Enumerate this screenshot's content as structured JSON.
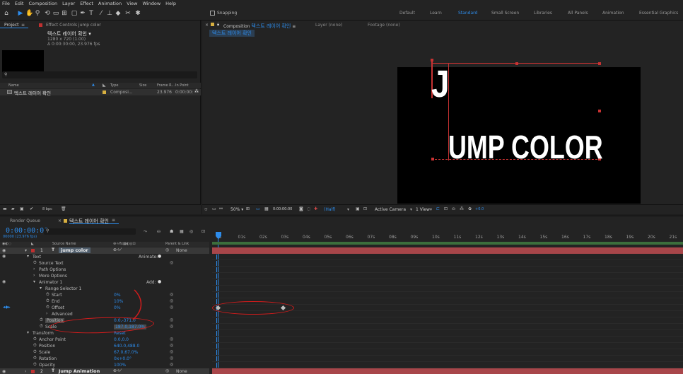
{
  "menu": [
    "File",
    "Edit",
    "Composition",
    "Layer",
    "Effect",
    "Animation",
    "View",
    "Window",
    "Help"
  ],
  "toolbar": {
    "snapping_label": "Snapping",
    "workspaces": [
      "Default",
      "Learn",
      "Standard",
      "Small Screen",
      "Libraries",
      "All Panels",
      "Animation",
      "Essential Graphics"
    ],
    "active_workspace": "Standard"
  },
  "project": {
    "tab_project": "Project",
    "tab_effect_controls": "Effect Controls jump color",
    "comp_name": "텍스트 레이어 확인",
    "comp_info_1": "1280 x 720 (1.00)",
    "comp_info_2": "Δ 0:00:30:00, 23.976 fps",
    "search_placeholder": "",
    "columns": [
      "Name",
      "Type",
      "Size",
      "Frame R...",
      "In Point"
    ],
    "items": [
      {
        "name": "텍스트 레이어 확인",
        "type": "Composi...",
        "size": "",
        "frame_rate": "23.976",
        "in_point": "0:00:00:"
      }
    ],
    "footer_bpc": "8 bpc"
  },
  "viewer": {
    "tab_composition": "Composition",
    "comp_tab_name": "텍스트 레이어 확인",
    "tab_layer": "Layer (none)",
    "tab_footage": "Footage (none)",
    "breadcrumb": "텍스트 레이어 확인",
    "canvas_text_top": "J",
    "canvas_text_main": "UMP COLOR",
    "footer": {
      "zoom": "50%",
      "timecode": "0:00:00:00",
      "resolution": "(Half)",
      "camera": "Active Camera",
      "views": "1 View",
      "exposure": "+0.0"
    }
  },
  "timeline": {
    "tab_render_queue": "Render Queue",
    "tab_comp": "텍스트 레이어 확인",
    "timecode": "0:00:00:00",
    "fps_note": "00000 (23.976 fps)",
    "search_placeholder": "",
    "columns": {
      "source_name": "Source Name",
      "parent_link": "Parent & Link"
    },
    "ruler": [
      "0s",
      "01s",
      "02s",
      "03s",
      "04s",
      "05s",
      "06s",
      "07s",
      "08s",
      "09s",
      "10s",
      "11s",
      "12s",
      "13s",
      "14s",
      "15s",
      "16s",
      "17s",
      "18s",
      "19s",
      "20s",
      "21s"
    ],
    "layers": [
      {
        "index": "1",
        "name": "jump color",
        "parent": "None"
      },
      {
        "index": "2",
        "name": "Jump Animation",
        "parent": "None"
      }
    ],
    "animate_label": "Animate:",
    "add_label": "Add:",
    "properties": [
      {
        "indent": 2,
        "label": "Text",
        "value": "",
        "twirl": "open"
      },
      {
        "indent": 3,
        "label": "Source Text",
        "value": "",
        "stopwatch": true
      },
      {
        "indent": 3,
        "label": "Path Options",
        "value": "",
        "twirl": "closed"
      },
      {
        "indent": 3,
        "label": "More Options",
        "value": "",
        "twirl": "closed"
      },
      {
        "indent": 3,
        "label": "Animator 1",
        "value": "",
        "twirl": "open"
      },
      {
        "indent": 4,
        "label": "Range Selector 1",
        "value": "",
        "twirl": "open"
      },
      {
        "indent": 5,
        "label": "Start",
        "value": "0%",
        "stopwatch": true
      },
      {
        "indent": 5,
        "label": "End",
        "value": "10%",
        "stopwatch": true
      },
      {
        "indent": 5,
        "label": "Offset",
        "value": "0%",
        "stopwatch": true
      },
      {
        "indent": 5,
        "label": "Advanced",
        "value": "",
        "twirl": "closed"
      },
      {
        "indent": 4,
        "label": "Position",
        "value": "0.0,-371.0",
        "stopwatch": true
      },
      {
        "indent": 4,
        "label": "Scale",
        "value": "187.0,187.0%",
        "stopwatch": true
      },
      {
        "indent": 2,
        "label": "Transform",
        "value": "Reset",
        "twirl": "open"
      },
      {
        "indent": 3,
        "label": "Anchor Point",
        "value": "0.0,0.0",
        "stopwatch": true
      },
      {
        "indent": 3,
        "label": "Position",
        "value": "640.0,488.0",
        "stopwatch": true
      },
      {
        "indent": 3,
        "label": "Scale",
        "value": "67.0,67.0%",
        "stopwatch": true
      },
      {
        "indent": 3,
        "label": "Rotation",
        "value": "0x+0.0°",
        "stopwatch": true
      },
      {
        "indent": 3,
        "label": "Opacity",
        "value": "100%",
        "stopwatch": true
      }
    ]
  }
}
